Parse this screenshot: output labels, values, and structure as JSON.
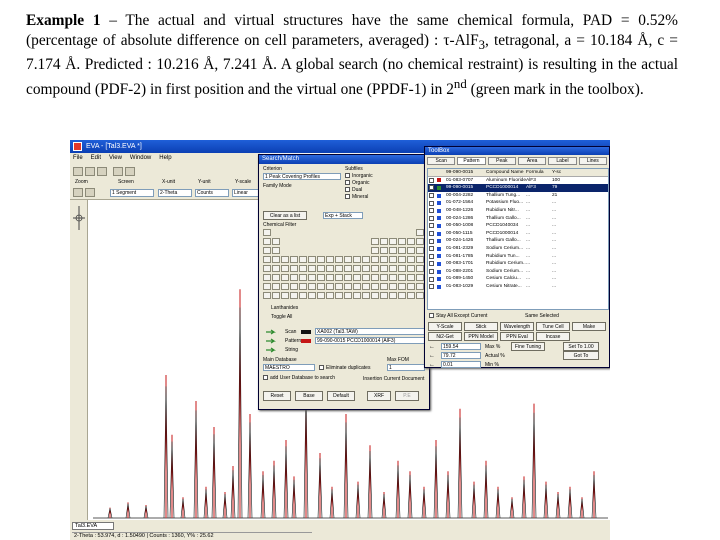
{
  "caption": {
    "label": "Example 1",
    "text_a": " – The actual and virtual structures have the same chemical formula, PAD = 0.52% (percentage of absolute difference on cell parameters, averaged) : τ-AlF",
    "sub3": "3",
    "text_b": ", tetragonal, a = 10.184 Å, c = 7.174 Å. Predicted : 10.216 Å, 7.241 Å. A global search (no chemical restraint) is resulting in the actual compound (PDF-2) in first position and the virtual one (PPDF-1) in 2",
    "sup_nd": "nd",
    "text_c": " (green mark in the toolbox)."
  },
  "app": {
    "title": "EVA - [Tal3.EVA *]",
    "menus": [
      "File",
      "Edit",
      "View",
      "Window",
      "Help"
    ],
    "toolbar": {
      "zoom_label": "Zoom",
      "screen_label": "Screen",
      "x_unit_label": "X-unit",
      "y_unit_label": "Y-unit",
      "y_scale_label": "Y-scale",
      "screen_value": "1 Segment",
      "x_unit_value": "2-Theta",
      "y_unit_value": "Counts",
      "y_scale_value": "Linear"
    },
    "status_tab": "Tal3.EVA",
    "status_coords": "2-Theta : 53.974, d : 1.50490 | Counts : 1360, Y% : 25.62"
  },
  "search": {
    "title": "Search/Match",
    "criterion_label": "Criterion",
    "criterion_value": "1 Peak Covering Profiles",
    "family_label": "Family Mode",
    "subfiles_label": "Subfiles",
    "subfiles": [
      "Inorganic",
      "Organic",
      "Dual",
      "Mineral"
    ],
    "clear_label": "Clear as a list",
    "chemical_label": "Chemical Filter",
    "range_label": "Exp + Stack",
    "lanthanides_label": "Lanthanides",
    "toggle_all_label": "Toggle All",
    "scan_label": "Scan",
    "scan_value": "XA002 (Tal3.TAW)",
    "pattern_label": "Pattern",
    "pattern_value": "99-090-0015 PCCD1000014 (AlF3)",
    "string_label": "String",
    "main_db_label": "Main Database",
    "max_fom_label": "Max FOM",
    "main_db_value": "MAESTRO",
    "eliminate_label": "Eliminate duplicates",
    "fom_value": "1",
    "add_user_label": "add User Database to search",
    "insert_label": "Insertion Current Document",
    "buttons": [
      "Reset",
      "Base",
      "Default",
      "XRF",
      "P.E"
    ]
  },
  "toolbox": {
    "title": "ToolBox",
    "tabs": [
      "Scan",
      "Pattern",
      "Peak",
      "Area",
      "Label",
      "Lines"
    ],
    "headers": [
      "99-090-0015",
      "Compound Name",
      "Formula",
      "Y-sc"
    ],
    "rows": [
      [
        "01-083-0707",
        "Aluminum Fluoride",
        "AlF3",
        "100",
        "red"
      ],
      [
        "99-090-0015",
        "PCCD1000014",
        "AlF3",
        "79",
        "green"
      ],
      [
        "00-004-2282",
        "Thallium Tung...",
        "...",
        "21",
        "blue"
      ],
      [
        "01-072-1564",
        "Potassium Fluo...",
        "...",
        "...",
        "blue"
      ],
      [
        "00-048-1226",
        "Rubidium Nitr...",
        "...",
        "...",
        "blue"
      ],
      [
        "00-024-1286",
        "Thallium Gallo...",
        "...",
        "...",
        "blue"
      ],
      [
        "00-050-1008",
        "PCCD1040034",
        "...",
        "...",
        "blue"
      ],
      [
        "00-050-1115",
        "PCCD1000014",
        "...",
        "...",
        "blue"
      ],
      [
        "00-024-1426",
        "Thallium Gallo...",
        "...",
        "...",
        "blue"
      ],
      [
        "01-081-2329",
        "Sodium Cerium...",
        "...",
        "...",
        "blue"
      ],
      [
        "01-081-1785",
        "Rubidium Tun...",
        "...",
        "...",
        "blue"
      ],
      [
        "00-083-1701",
        "Rubidium Cerium...",
        "...",
        "...",
        "blue"
      ],
      [
        "01-088-2201",
        "Sodium Cerium...",
        "...",
        "...",
        "blue"
      ],
      [
        "01-089-1450",
        "Cesium Calciu...",
        "...",
        "...",
        "blue"
      ],
      [
        "01-083-1029",
        "Cesium Nitrate...",
        "...",
        "...",
        "blue"
      ]
    ],
    "stay_label": "Stay All Except Current",
    "same_selected_label": "Same Selected",
    "btn_row1": [
      "Y-Scale",
      "Stick",
      "Wavelength",
      "Tune Cell",
      "Make"
    ],
    "btn_row2": [
      "Ni2-Get",
      "PPN Model",
      "PPN Eval",
      "Incase"
    ],
    "fields": [
      {
        "value": "159.54",
        "label": "Max %",
        "button": "Fine Tuning",
        "button2": "Set To 1.00"
      },
      {
        "value": "79.72",
        "label": "Actual %",
        "button": "",
        "button2": "Got To"
      },
      {
        "value": "0.01",
        "label": "Min %",
        "button": "",
        "button2": ""
      }
    ]
  },
  "colors": {
    "title_bar": "#0b3fb3",
    "pattern_red": "#c51616",
    "scan_black": "#111111",
    "match_green": "#2e8b2e",
    "sticks_blue": "#1f4fd6"
  }
}
